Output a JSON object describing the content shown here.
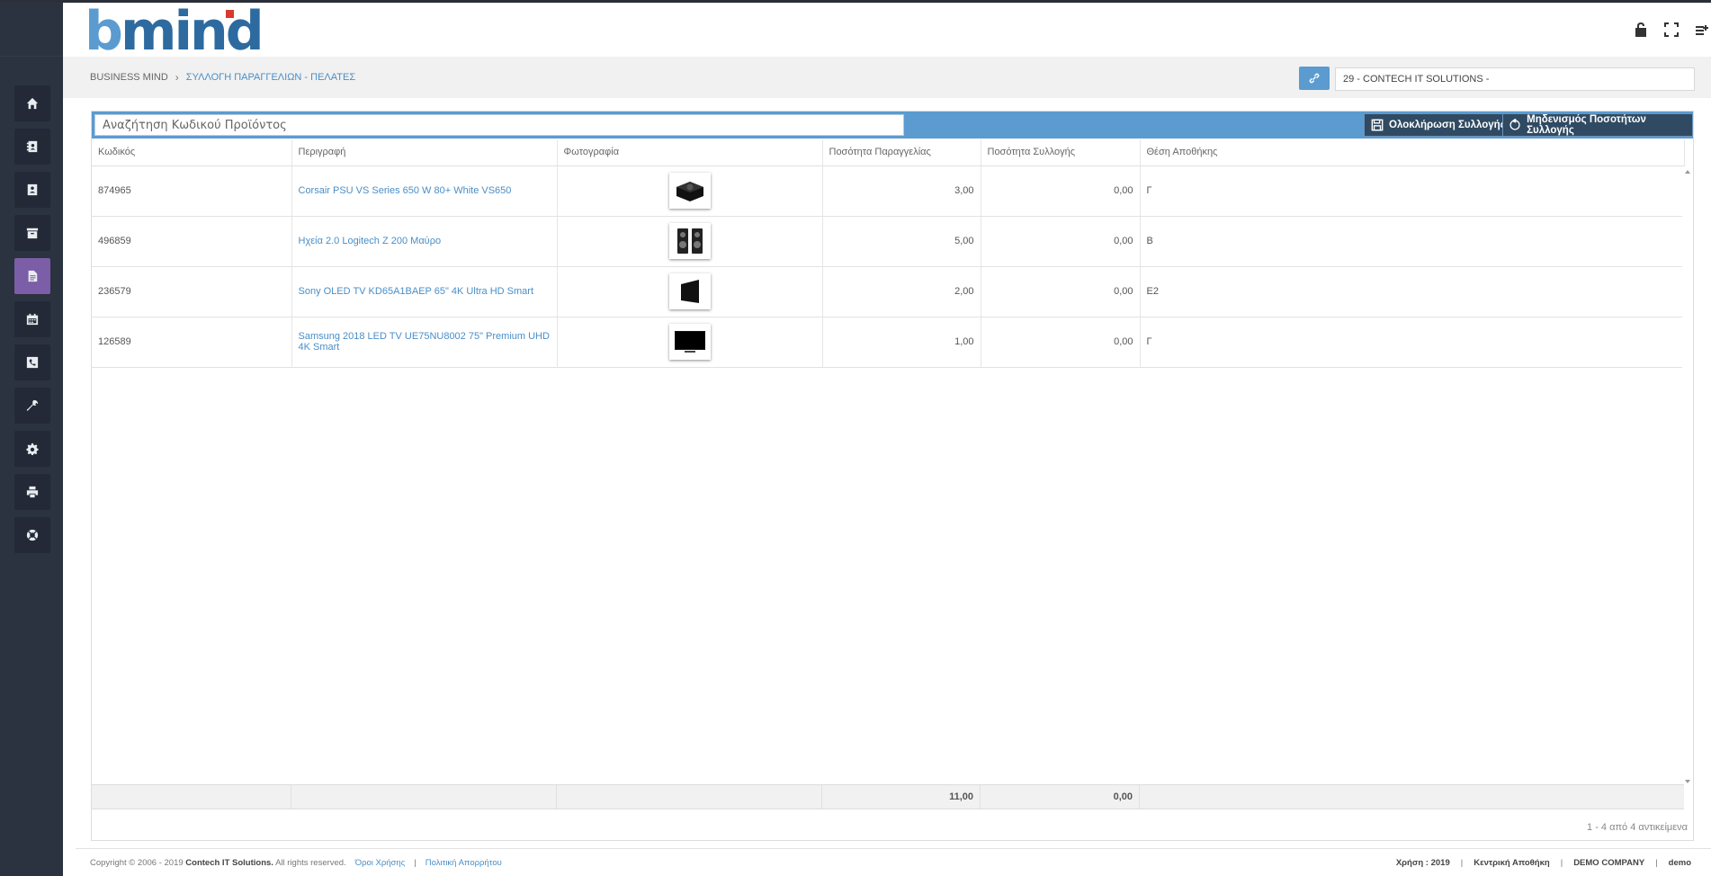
{
  "header": {
    "logo": "bmind"
  },
  "breadcrumb": {
    "home": "BUSINESS MIND",
    "current": "ΣΥΛΛΟΓΗ ΠΑΡΑΓΓΕΛΙΩΝ - ΠΕΛΑΤΕΣ"
  },
  "customer": {
    "value": "29 - CONTECH IT SOLUTIONS -"
  },
  "toolbar": {
    "search_placeholder": "Αναζήτηση Κωδικού Προϊόντος",
    "complete_label": "Ολοκλήρωση Συλλογής",
    "reset_label": "Μηδενισμός Ποσοτήτων Συλλογής"
  },
  "grid": {
    "columns": [
      "Κωδικός",
      "Περιγραφή",
      "Φωτογραφία",
      "Ποσότητα Παραγγελίας",
      "Ποσότητα Συλλογής",
      "Θέση Αποθήκης"
    ],
    "rows": [
      {
        "code": "874965",
        "description": "Corsair PSU VS Series 650 W 80+ White VS650",
        "photo_icon": "psu-icon",
        "ordered": "3,00",
        "collected": "0,00",
        "location": "Γ"
      },
      {
        "code": "496859",
        "description": "Ηχεία 2.0 Logitech Z 200 Μαύρο",
        "photo_icon": "speakers-icon",
        "ordered": "5,00",
        "collected": "0,00",
        "location": "Β"
      },
      {
        "code": "236579",
        "description": "Sony OLED TV KD65A1BAEP 65\" 4K Ultra HD Smart",
        "photo_icon": "tv-icon",
        "ordered": "2,00",
        "collected": "0,00",
        "location": "Ε2"
      },
      {
        "code": "126589",
        "description": "Samsung 2018 LED TV UE75NU8002 75\" Premium UHD 4K Smart",
        "photo_icon": "tv-icon",
        "ordered": "1,00",
        "collected": "0,00",
        "location": "Γ"
      }
    ],
    "totals": {
      "ordered": "11,00",
      "collected": "0,00"
    },
    "pager": "1 - 4 από 4 αντικείμενα"
  },
  "footer": {
    "copyright": "Copyright © 2006 - 2019",
    "company": "Contech IT Solutions.",
    "rights": "All rights reserved.",
    "terms": "Όροι Χρήσης",
    "privacy": "Πολιτική Απορρήτου",
    "year": "Χρήση : 2019",
    "warehouse": "Κεντρική Αποθήκη",
    "demo_company": "DEMO COMPANY",
    "user": "demo"
  },
  "sidebar": {
    "items": [
      {
        "icon": "home-icon"
      },
      {
        "icon": "contacts-icon"
      },
      {
        "icon": "customer-card-icon"
      },
      {
        "icon": "archive-icon"
      },
      {
        "icon": "document-icon",
        "active": true
      },
      {
        "icon": "calendar-icon"
      },
      {
        "icon": "phone-icon"
      },
      {
        "icon": "wrench-icon"
      },
      {
        "icon": "gear-icon"
      },
      {
        "icon": "print-icon"
      },
      {
        "icon": "support-icon"
      }
    ]
  },
  "colors": {
    "sidebar": "#2b3240",
    "accent": "#5b9bd0",
    "active_nav": "#7b5ea7",
    "link": "#4a8ec6",
    "button_dark": "#2f4a62"
  }
}
